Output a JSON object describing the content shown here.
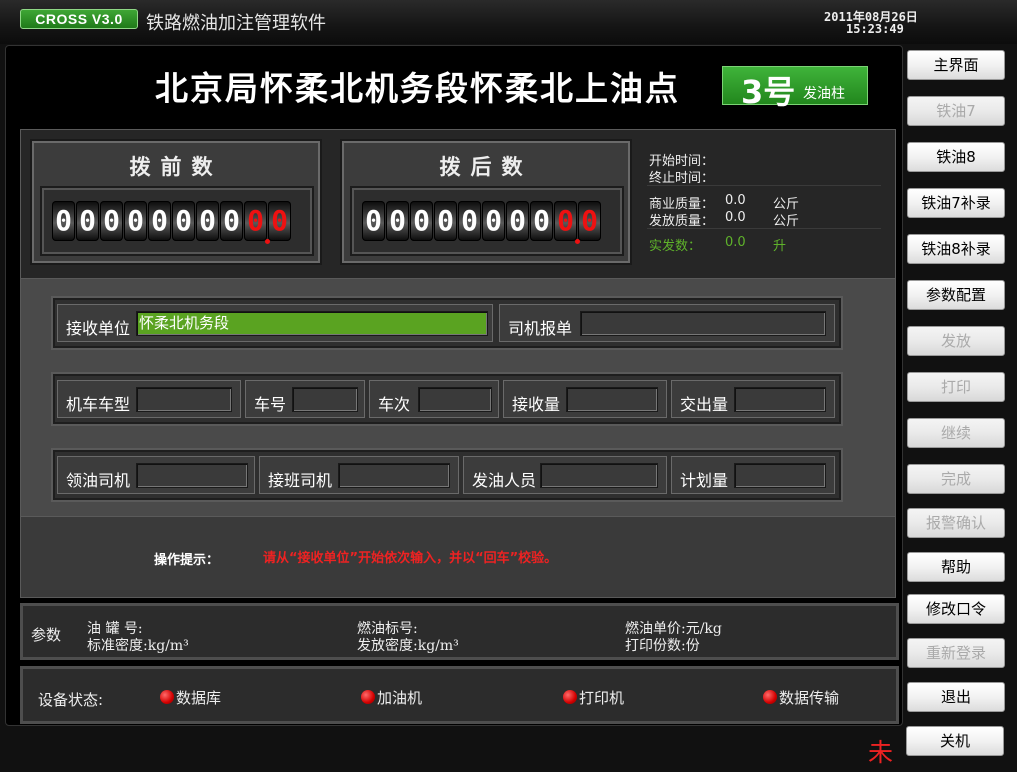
{
  "app": {
    "badge": "CROSS V3.0",
    "title": "铁路燃油加注管理软件",
    "date": "2011年08月26日",
    "time": "15:23:49"
  },
  "station": {
    "title": "北京局怀柔北机务段怀柔北上油点",
    "pump_number": "3号",
    "pump_suffix": "发油柱"
  },
  "counters": {
    "before": {
      "title": "拨前数",
      "digits": [
        "0",
        "0",
        "0",
        "0",
        "0",
        "0",
        "0",
        "0",
        "0",
        "0"
      ]
    },
    "after": {
      "title": "拨后数",
      "digits": [
        "0",
        "0",
        "0",
        "0",
        "0",
        "0",
        "0",
        "0",
        "0",
        "0"
      ]
    }
  },
  "info": {
    "start_time_label": "开始时间：",
    "end_time_label": "终止时间：",
    "commercial_mass_label": "商业质量：",
    "commercial_mass_value": "0.0",
    "commercial_mass_unit": "公斤",
    "dispatched_mass_label": "发放质量：",
    "dispatched_mass_value": "0.0",
    "dispatched_mass_unit": "公斤",
    "actual_label": "实发数：",
    "actual_value": "0.0",
    "actual_unit": "升"
  },
  "form": {
    "receiver_label": "接收单位",
    "receiver_value": "怀柔北机务段",
    "driver_report_label": "司机报单",
    "loco_type_label": "机车车型",
    "loco_no_label": "车号",
    "train_no_label": "车次",
    "receive_qty_label": "接收量",
    "handover_qty_label": "交出量",
    "fuel_driver_label": "领油司机",
    "shift_driver_label": "接班司机",
    "dispenser_label": "发油人员",
    "plan_qty_label": "计划量"
  },
  "prompt": {
    "label": "操作提示：",
    "text": "请从“接收单位”开始依次输入，并以“回车”校验。"
  },
  "params": {
    "title": "参数",
    "tank_no": "油 罐 号:",
    "std_density": "标准密度:kg/m³",
    "fuel_grade": "燃油标号:",
    "dispatch_density": "发放密度:kg/m³",
    "unit_price": "燃油单价:元/kg",
    "print_copies": "打印份数:份"
  },
  "status": {
    "label": "设备状态:",
    "items": [
      "数据库",
      "加油机",
      "打印机",
      "数据传输"
    ],
    "color": "#d40000"
  },
  "buttons": {
    "main": "主界面",
    "oil7": "铁油7",
    "oil8": "铁油8",
    "oil7_supp": "铁油7补录",
    "oil8_supp": "铁油8补录",
    "params_config": "参数配置",
    "dispatch": "发放",
    "print": "打印",
    "continue": "继续",
    "complete": "完成",
    "alarm_confirm": "报警确认",
    "help": "帮助",
    "change_password": "修改口令",
    "relogin": "重新登录",
    "exit": "退出",
    "shutdown": "关机"
  },
  "corner_mark": "未",
  "colors": {
    "accent_green": "#3fa635",
    "input_green": "#5aa321",
    "warning_red": "#ee2222"
  }
}
